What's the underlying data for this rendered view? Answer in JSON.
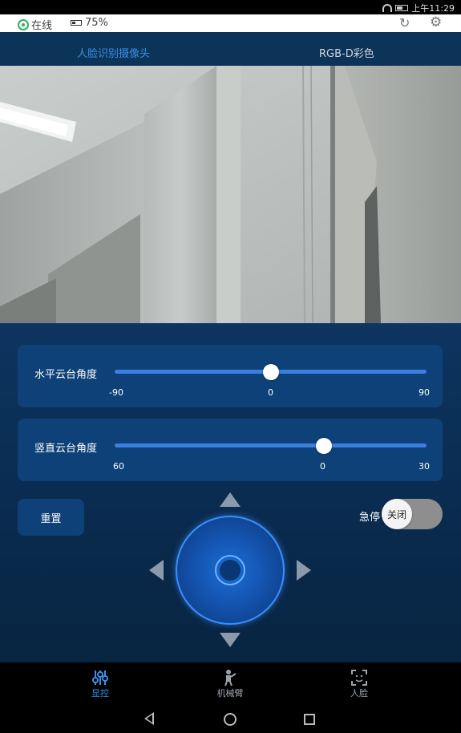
{
  "system_bar": {
    "time": "上午11:29"
  },
  "status": {
    "online_label": "在线",
    "battery_label": "75%"
  },
  "tabs": [
    {
      "label": "人脸识别摄像头",
      "active": true
    },
    {
      "label": "RGB-D彩色",
      "active": false
    }
  ],
  "sliders": {
    "horizontal": {
      "label": "水平云台角度",
      "min_label": "-90",
      "mid_label": "0",
      "max_label": "90",
      "value_fraction": 0.5
    },
    "vertical": {
      "label": "竖直云台角度",
      "min_label": "60",
      "mid_label": "0",
      "max_label": "30",
      "value_fraction": 0.67
    }
  },
  "controls": {
    "reset_label": "重置",
    "estop_label": "急停",
    "estop_toggle_label": "关闭",
    "estop_on": false
  },
  "bottom_nav": [
    {
      "label": "显控",
      "icon": "sliders-icon",
      "active": true
    },
    {
      "label": "机械臂",
      "icon": "robot-arm-icon",
      "active": false
    },
    {
      "label": "人脸",
      "icon": "face-scan-icon",
      "active": false
    }
  ],
  "colors": {
    "accent": "#3b8fe8",
    "panel_bg": "#0a2a4a",
    "card_bg": "#0d4177",
    "online_green": "#2db45a"
  }
}
